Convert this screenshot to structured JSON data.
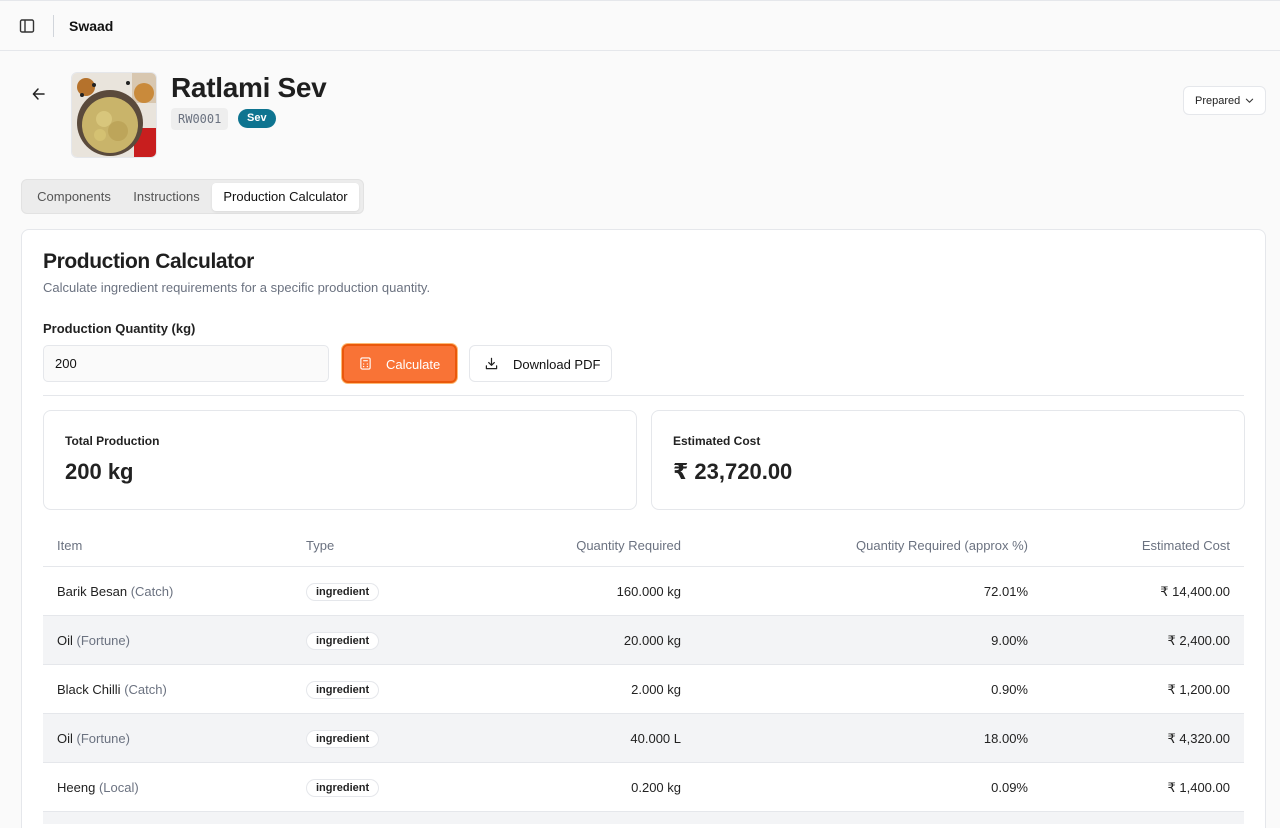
{
  "app": {
    "title": "Swaad"
  },
  "product": {
    "name": "Ratlami Sev",
    "sku": "RW0001",
    "category": "Sev",
    "status": "Prepared"
  },
  "tabs": [
    {
      "label": "Components",
      "active": false
    },
    {
      "label": "Instructions",
      "active": false
    },
    {
      "label": "Production Calculator",
      "active": true
    }
  ],
  "calculator": {
    "title": "Production Calculator",
    "description": "Calculate ingredient requirements for a specific production quantity.",
    "quantity_label": "Production Quantity (kg)",
    "quantity_value": "200",
    "calculate_label": "Calculate",
    "download_label": "Download PDF",
    "accent": "#f97336"
  },
  "summary": {
    "total_label": "Total Production",
    "total_value": "200 kg",
    "cost_label": "Estimated Cost",
    "cost_value": "₹ 23,720.00"
  },
  "table": {
    "headers": [
      "Item",
      "Type",
      "Quantity Required",
      "Quantity Required (approx %)",
      "Estimated Cost"
    ],
    "rows": [
      {
        "item": "Barik Besan",
        "brand": "(Catch)",
        "type": "ingredient",
        "qty": "160.000 kg",
        "pct": "72.01%",
        "cost": "₹ 14,400.00"
      },
      {
        "item": "Oil",
        "brand": "(Fortune)",
        "type": "ingredient",
        "qty": "20.000 kg",
        "pct": "9.00%",
        "cost": "₹ 2,400.00"
      },
      {
        "item": "Black Chilli",
        "brand": "(Catch)",
        "type": "ingredient",
        "qty": "2.000 kg",
        "pct": "0.90%",
        "cost": "₹ 1,200.00"
      },
      {
        "item": "Oil",
        "brand": "(Fortune)",
        "type": "ingredient",
        "qty": "40.000 L",
        "pct": "18.00%",
        "cost": "₹ 4,320.00"
      },
      {
        "item": "Heeng",
        "brand": "(Local)",
        "type": "ingredient",
        "qty": "0.200 kg",
        "pct": "0.09%",
        "cost": "₹ 1,400.00"
      }
    ]
  },
  "icons": {
    "sidebar": "sidebar-toggle-icon",
    "back": "arrow-left-icon",
    "calculator": "calculator-icon",
    "download": "download-icon",
    "chevron": "chevron-down-icon"
  }
}
